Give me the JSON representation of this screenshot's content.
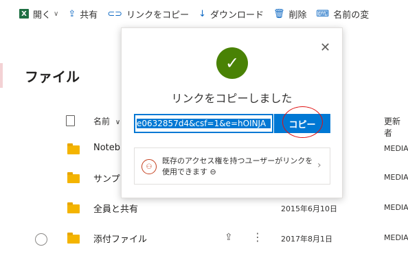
{
  "toolbar": {
    "open_label": "開く",
    "share_label": "共有",
    "copy_link_label": "リンクをコピー",
    "download_label": "ダウンロード",
    "delete_label": "削除",
    "rename_label": "名前の変"
  },
  "page": {
    "title": "ファイル"
  },
  "table": {
    "headers": {
      "name": "名前",
      "modified_by": "更新者"
    },
    "rows": [
      {
        "name": "Noteb",
        "date": "",
        "modified_by": "MEDIA"
      },
      {
        "name": "サンプ",
        "date": "",
        "modified_by": "MEDIA"
      },
      {
        "name": "全員と共有",
        "date": "2015年6月10日",
        "modified_by": "MEDIA"
      },
      {
        "name": "添付ファイル",
        "date": "2017年8月1日",
        "modified_by": "MEDIA"
      }
    ]
  },
  "dialog": {
    "title": "リンクをコピーしました",
    "link_value": "e0632857d4&csf=1&e=hOINJA",
    "copy_button": "コピー",
    "access_text": "既存のアクセス権を持つユーザーがリンクを使用できます ⊖"
  },
  "colors": {
    "accent": "#0078d4",
    "success": "#498205",
    "folder": "#f4b400",
    "annotation": "#e01010"
  },
  "icons": {
    "excel": "excel-icon",
    "share": "share-icon",
    "link": "link-icon",
    "download": "download-icon",
    "delete": "trash-icon",
    "rename": "rename-icon",
    "close": "close-icon",
    "check": "check-icon",
    "access": "people-access-icon"
  }
}
